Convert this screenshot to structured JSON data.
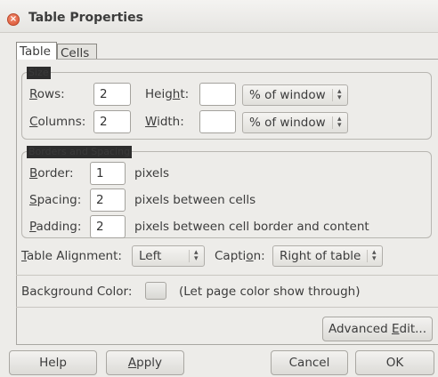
{
  "window": {
    "title": "Table Properties"
  },
  "tabs": [
    {
      "label": "Table",
      "active": true
    },
    {
      "label": "Cells",
      "active": false
    }
  ],
  "size_group": {
    "legend": "Size",
    "rows_label": "Rows:",
    "rows_value": "2",
    "height_label": "Height:",
    "height_value": "",
    "height_unit": "% of window",
    "columns_label": "Columns:",
    "columns_value": "2",
    "width_label": "Width:",
    "width_value": "",
    "width_unit": "% of window"
  },
  "border_group": {
    "legend": "Borders and Spacing",
    "border_label": "Border:",
    "border_value": "1",
    "border_unit": "pixels",
    "spacing_label": "Spacing:",
    "spacing_value": "2",
    "spacing_unit": "pixels between cells",
    "padding_label": "Padding:",
    "padding_value": "2",
    "padding_unit": "pixels between cell border and content"
  },
  "alignment": {
    "label": "Table Alignment:",
    "value": "Left",
    "caption_label": "Caption:",
    "caption_value": "Right of table"
  },
  "background": {
    "label": "Background Color:",
    "note": "(Let page color show through)"
  },
  "advanced_edit_label": "Advanced Edit...",
  "buttons": {
    "help": "Help",
    "apply": "Apply",
    "cancel": "Cancel",
    "ok": "OK"
  },
  "icons": {
    "close": "close-icon",
    "arrows": "spinner-arrows-icon"
  },
  "colors": {
    "close": "#d95232",
    "legend_fill": "#2d2d2d",
    "window_bg": "#edece9"
  }
}
